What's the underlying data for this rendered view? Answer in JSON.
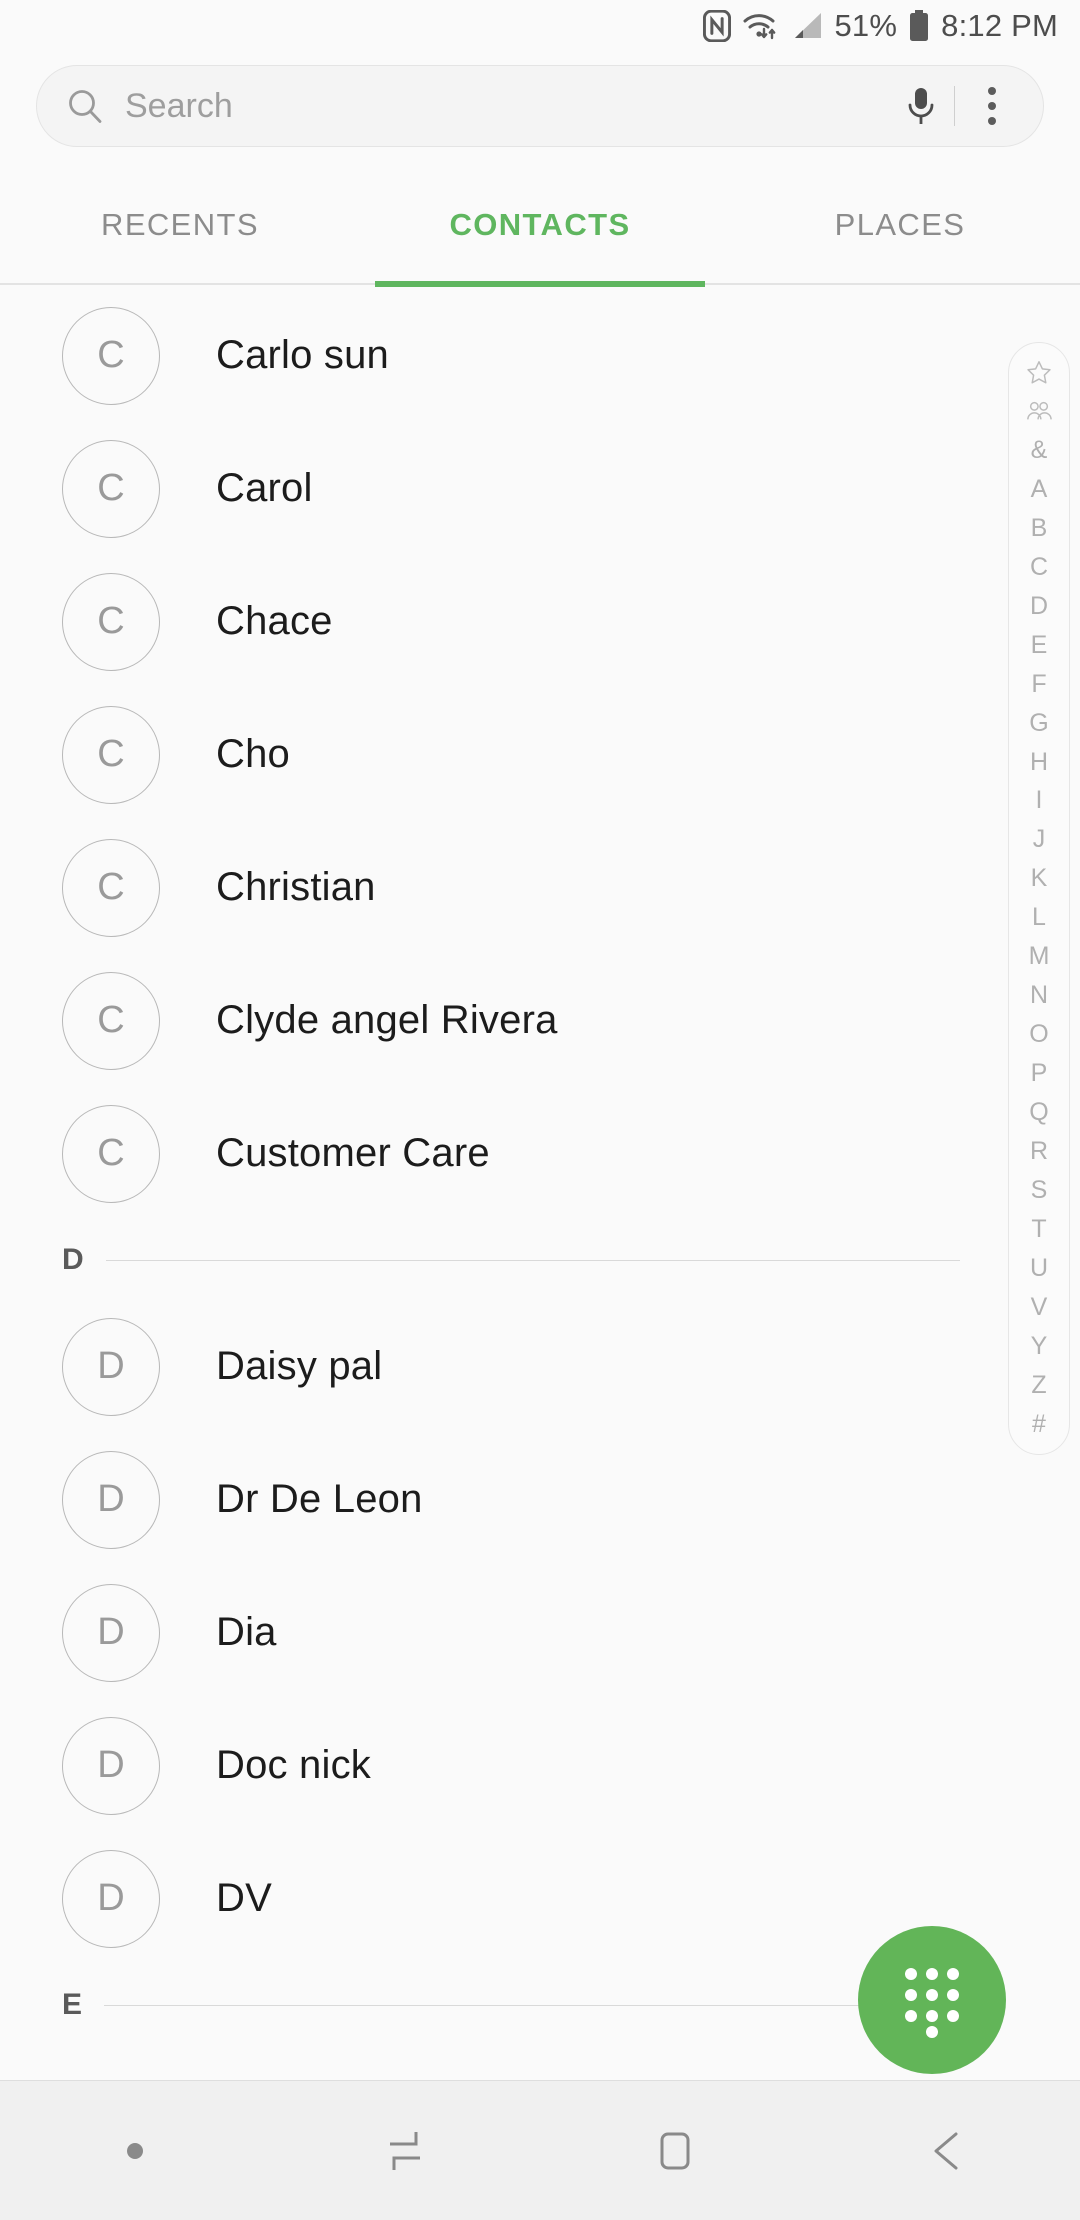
{
  "status_bar": {
    "icons": [
      "nfc-icon",
      "wifi-icon",
      "cellular-signal-icon",
      "battery-icon"
    ],
    "battery_percent": "51%",
    "time": "8:12 PM"
  },
  "search": {
    "placeholder": "Search",
    "value": "",
    "icons": [
      "search-icon",
      "microphone-icon",
      "overflow-menu-icon"
    ]
  },
  "tabs": [
    {
      "label": "RECENTS",
      "active": false
    },
    {
      "label": "CONTACTS",
      "active": true
    },
    {
      "label": "PLACES",
      "active": false
    }
  ],
  "colors": {
    "accent": "#5fb65f",
    "fab": "#62b558",
    "background": "#fafafa",
    "name_text": "#1c1c1c",
    "muted_text": "#9a9a9a"
  },
  "contacts": [
    {
      "type": "contact",
      "initial": "C",
      "name": "Carlo sun"
    },
    {
      "type": "contact",
      "initial": "C",
      "name": "Carol"
    },
    {
      "type": "contact",
      "initial": "C",
      "name": "Chace"
    },
    {
      "type": "contact",
      "initial": "C",
      "name": "Cho"
    },
    {
      "type": "contact",
      "initial": "C",
      "name": "Christian"
    },
    {
      "type": "contact",
      "initial": "C",
      "name": "Clyde angel Rivera"
    },
    {
      "type": "contact",
      "initial": "C",
      "name": "Customer Care"
    },
    {
      "type": "section",
      "letter": "D"
    },
    {
      "type": "contact",
      "initial": "D",
      "name": "Daisy pal"
    },
    {
      "type": "contact",
      "initial": "D",
      "name": "Dr De Leon"
    },
    {
      "type": "contact",
      "initial": "D",
      "name": "Dia"
    },
    {
      "type": "contact",
      "initial": "D",
      "name": "Doc nick"
    },
    {
      "type": "contact",
      "initial": "D",
      "name": "DV"
    },
    {
      "type": "section",
      "letter": "E"
    }
  ],
  "alphabet_index": [
    {
      "kind": "icon",
      "label": "star-icon"
    },
    {
      "kind": "icon",
      "label": "group-icon"
    },
    {
      "kind": "text",
      "label": "&"
    },
    {
      "kind": "text",
      "label": "A"
    },
    {
      "kind": "text",
      "label": "B"
    },
    {
      "kind": "text",
      "label": "C"
    },
    {
      "kind": "text",
      "label": "D"
    },
    {
      "kind": "text",
      "label": "E"
    },
    {
      "kind": "text",
      "label": "F"
    },
    {
      "kind": "text",
      "label": "G"
    },
    {
      "kind": "text",
      "label": "H"
    },
    {
      "kind": "text",
      "label": "I"
    },
    {
      "kind": "text",
      "label": "J"
    },
    {
      "kind": "text",
      "label": "K"
    },
    {
      "kind": "text",
      "label": "L"
    },
    {
      "kind": "text",
      "label": "M"
    },
    {
      "kind": "text",
      "label": "N"
    },
    {
      "kind": "text",
      "label": "O"
    },
    {
      "kind": "text",
      "label": "P"
    },
    {
      "kind": "text",
      "label": "Q"
    },
    {
      "kind": "text",
      "label": "R"
    },
    {
      "kind": "text",
      "label": "S"
    },
    {
      "kind": "text",
      "label": "T"
    },
    {
      "kind": "text",
      "label": "U"
    },
    {
      "kind": "text",
      "label": "V"
    },
    {
      "kind": "text",
      "label": "Y"
    },
    {
      "kind": "text",
      "label": "Z"
    },
    {
      "kind": "text",
      "label": "#"
    }
  ],
  "fab": {
    "icon": "dialpad-icon"
  },
  "navbar": {
    "items": [
      "indicator-dot",
      "recents-icon",
      "home-icon",
      "back-icon"
    ]
  }
}
